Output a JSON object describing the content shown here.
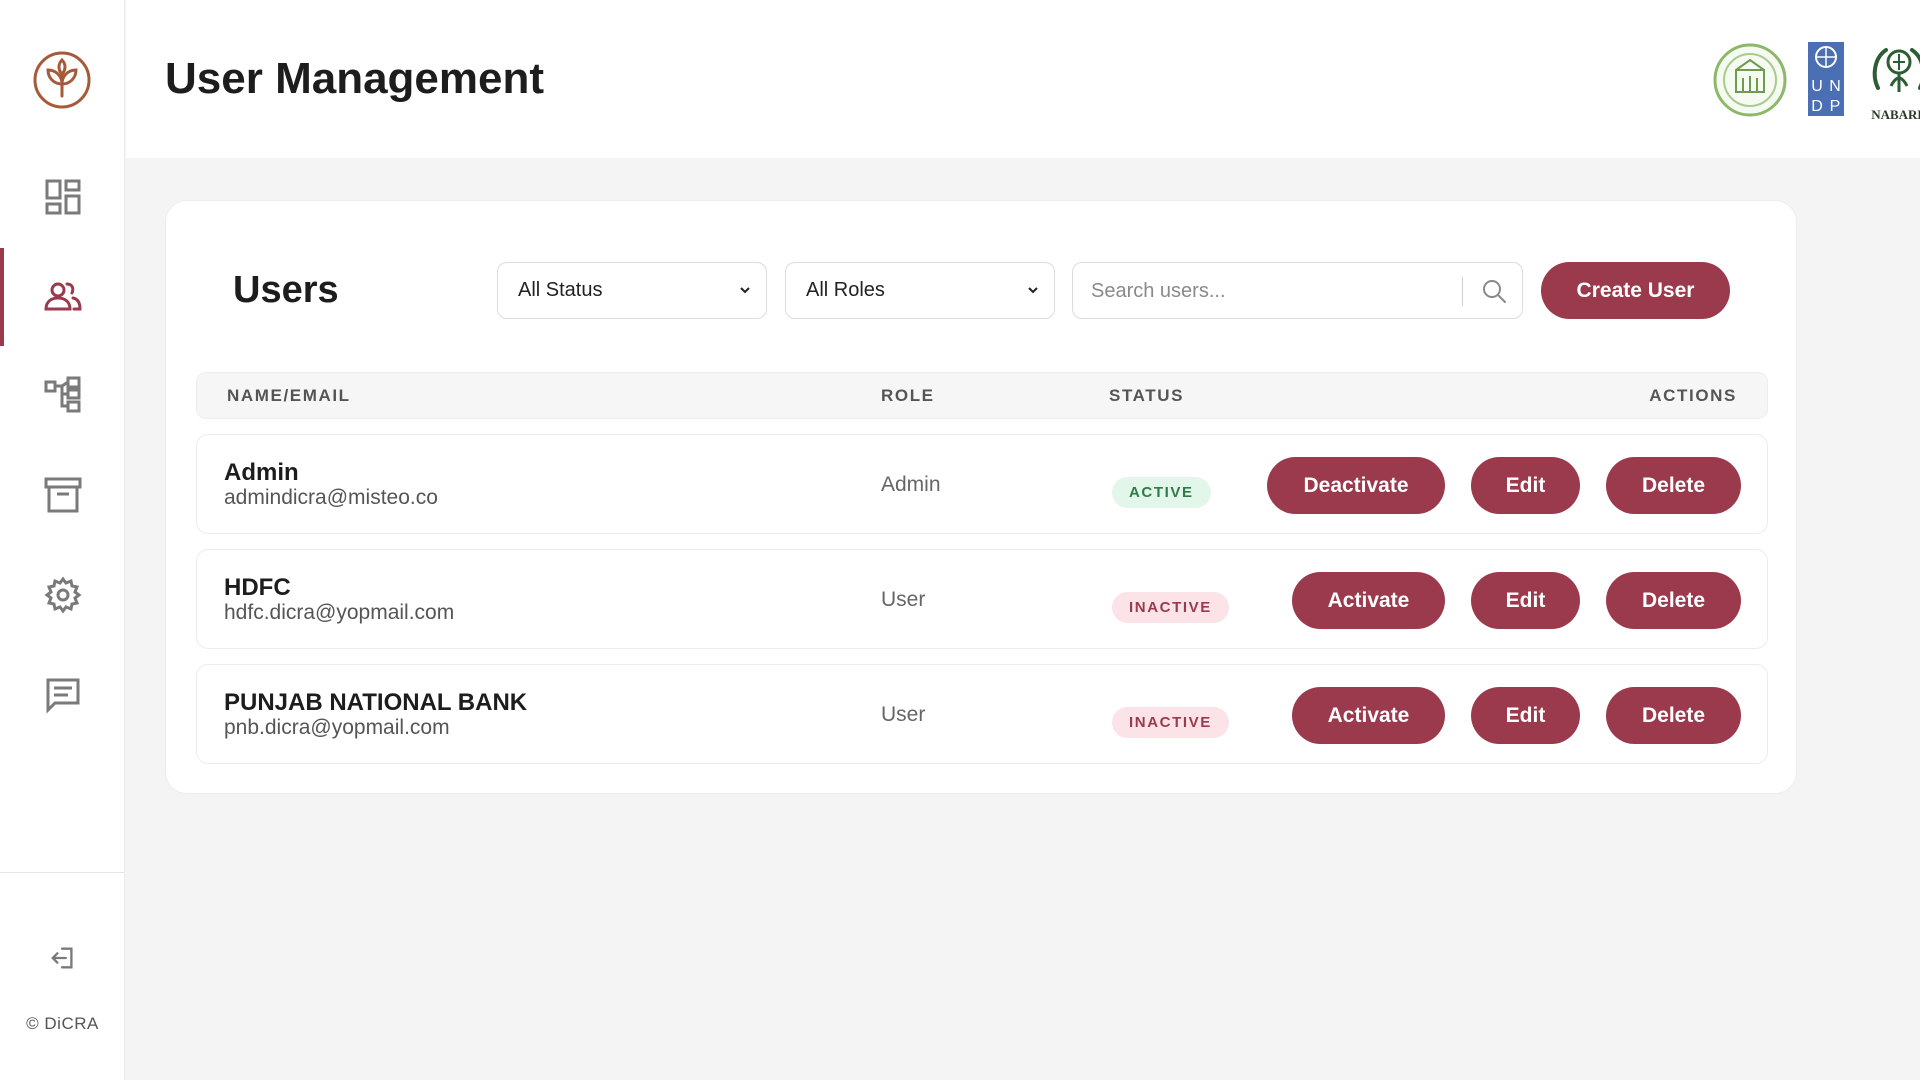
{
  "header": {
    "title": "User Management"
  },
  "sidebar": {
    "items": [
      {
        "name": "dashboard",
        "icon": "dashboard-icon"
      },
      {
        "name": "users",
        "icon": "users-icon",
        "active": true
      },
      {
        "name": "hierarchy",
        "icon": "hierarchy-icon"
      },
      {
        "name": "archive",
        "icon": "archive-icon"
      },
      {
        "name": "settings",
        "icon": "gear-icon"
      },
      {
        "name": "messages",
        "icon": "message-icon"
      }
    ],
    "logout_icon": "logout-icon",
    "copyright": "© DiCRA"
  },
  "partners": {
    "nabard_label": "NABARD",
    "undp_letters": [
      "U",
      "N",
      "D",
      "P"
    ]
  },
  "users_panel": {
    "title": "Users",
    "status_filter": {
      "selected": "All Status"
    },
    "role_filter": {
      "selected": "All Roles"
    },
    "search": {
      "placeholder": "Search users...",
      "value": ""
    },
    "create_label": "Create User",
    "columns": [
      "NAME/EMAIL",
      "ROLE",
      "STATUS",
      "ACTIONS"
    ],
    "rows": [
      {
        "name": "Admin",
        "email": "admindicra@misteo.co",
        "role": "Admin",
        "status": "ACTIVE",
        "toggle_label": "Deactivate",
        "edit_label": "Edit",
        "delete_label": "Delete"
      },
      {
        "name": "HDFC",
        "email": "hdfc.dicra@yopmail.com",
        "role": "User",
        "status": "INACTIVE",
        "toggle_label": "Activate",
        "edit_label": "Edit",
        "delete_label": "Delete"
      },
      {
        "name": "PUNJAB NATIONAL BANK",
        "email": "pnb.dicra@yopmail.com",
        "role": "User",
        "status": "INACTIVE",
        "toggle_label": "Activate",
        "edit_label": "Edit",
        "delete_label": "Delete"
      }
    ]
  },
  "colors": {
    "accent": "#9b3a4c",
    "active_badge_bg": "#e2f6ea",
    "active_badge_text": "#2f7a4b",
    "inactive_badge_bg": "#fbe3e8",
    "inactive_badge_text": "#9b3a4c",
    "brand_logo": "#a55a3a"
  }
}
